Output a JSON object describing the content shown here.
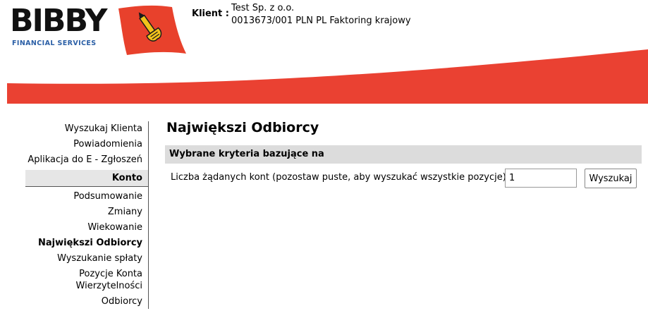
{
  "brand": {
    "name": "BIBBY",
    "subtitle": "FINANCIAL SERVICES",
    "accent_red": "#e8412c",
    "subtitle_blue": "#2b5fa6"
  },
  "client": {
    "label": "Klient :",
    "name": "Test Sp. z o.o.",
    "account": "0013673/001 PLN PL Faktoring krajowy"
  },
  "sidebar": {
    "top_items": [
      {
        "label": "Wyszukaj Klienta"
      },
      {
        "label": "Powiadomienia"
      },
      {
        "label": "Aplikacja do E - Zgłoszeń"
      }
    ],
    "section_title": "Konto",
    "account_items": [
      {
        "label": "Podsumowanie"
      },
      {
        "label": "Zmiany"
      },
      {
        "label": "Wiekowanie"
      },
      {
        "label": "Największi Odbiorcy",
        "active": true
      },
      {
        "label": "Wyszukanie spłaty"
      },
      {
        "label": "Pozycje Konta Wierzytelności"
      },
      {
        "label": "Odbiorcy"
      }
    ]
  },
  "main": {
    "title": "Największi Odbiorcy",
    "criteria_header": "Wybrane kryteria bazujące na",
    "field_label": "Liczba żądanych kont (pozostaw puste, aby wyszukać wszystkie pozycje)",
    "field_value": "1",
    "search_button": "Wyszukaj"
  }
}
